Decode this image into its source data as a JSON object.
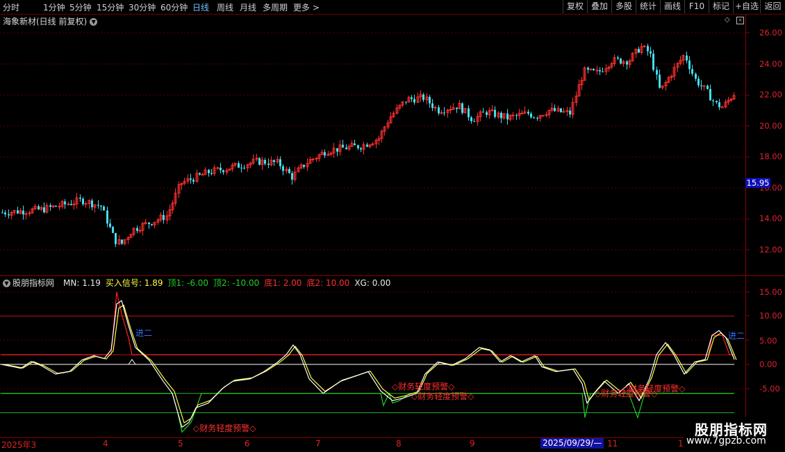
{
  "toolbar": {
    "timeframes": [
      "分时",
      "1分钟",
      "5分钟",
      "15分钟",
      "30分钟",
      "60分钟",
      "日线",
      "周线",
      "月线",
      "多周期",
      "更多 >"
    ],
    "active_timeframe": "日线",
    "buttons": [
      "复权",
      "叠加",
      "多股",
      "统计",
      "画线",
      "F10",
      "标记",
      "+自选",
      "返回"
    ]
  },
  "stock": {
    "title": "海象新材(日线 前复权)"
  },
  "price_axis": {
    "labels": [
      "26.00",
      "24.00",
      "22.00",
      "20.00",
      "18.00",
      "16.00",
      "14.00",
      "12.00"
    ]
  },
  "current_price_tag": "15.95",
  "indicator": {
    "name": "股朋指标网",
    "items": [
      {
        "label": "MN: 1.19",
        "color": "#e8e8e8"
      },
      {
        "label": "买入信号: 1.89",
        "color": "#ffff40"
      },
      {
        "label": "顶1: -6.00",
        "color": "#20d020"
      },
      {
        "label": "顶2: -10.00",
        "color": "#20d020"
      },
      {
        "label": "底1: 2.00",
        "color": "#ff3030"
      },
      {
        "label": "底2: 10.00",
        "color": "#ff3030"
      },
      {
        "label": "XG: 0.00",
        "color": "#e8e8e8"
      }
    ],
    "axis_labels": [
      "15.00",
      "10.00",
      "5.00",
      "0.00",
      "-5.00"
    ]
  },
  "annotations": {
    "jin_er": "进二",
    "warning": "◇财务轻度预警◇"
  },
  "date_axis": {
    "ticks": [
      "2025年3",
      "4",
      "5",
      "6",
      "7",
      "8",
      "9",
      "11",
      "1"
    ],
    "selected_date": "2025/09/29/—"
  },
  "watermark": {
    "name": "股朋指标网",
    "url": "www.7gpzb.com"
  },
  "colors": {
    "up": "#ff3030",
    "down": "#40e0f0",
    "grid": "#5a0000",
    "main": "#ffffff",
    "signal": "#ffff40"
  }
}
